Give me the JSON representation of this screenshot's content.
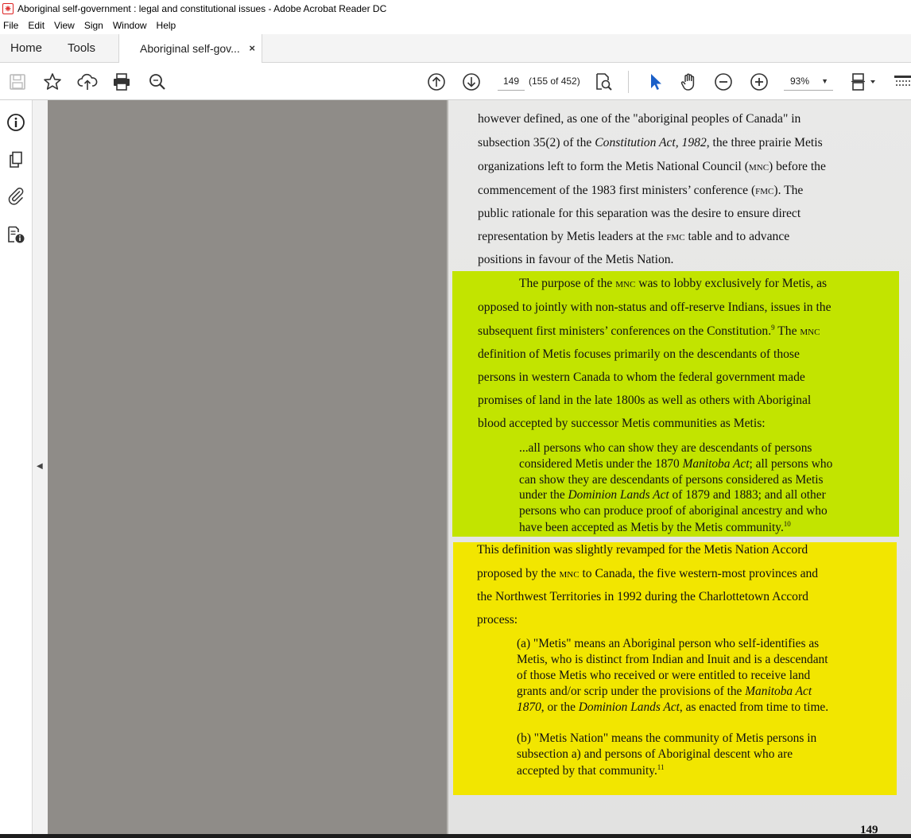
{
  "window": {
    "title": "Aboriginal self-government : legal and constitutional issues - Adobe Acrobat Reader DC"
  },
  "menu": [
    "File",
    "Edit",
    "View",
    "Sign",
    "Window",
    "Help"
  ],
  "tabs": {
    "home": "Home",
    "tools": "Tools",
    "document": "Aboriginal self-gov...",
    "close": "×"
  },
  "toolbar": {
    "page_number": "149",
    "page_count": "(155 of 452)",
    "zoom": "93%",
    "icons": [
      "save-icon",
      "bookmark-star-icon",
      "upload-icon",
      "print-icon",
      "search-zoom-icon",
      "page-up-icon",
      "page-down-icon",
      "find-page-icon",
      "select-cursor-icon",
      "hand-icon",
      "zoom-out-icon",
      "zoom-in-icon",
      "page-layout-icon",
      "more-tools-icon"
    ]
  },
  "left_rail": [
    "info-icon",
    "pages-icon",
    "attachment-icon",
    "document-properties-icon"
  ],
  "document": {
    "para1": [
      "however defined, as one of the \"aboriginal peoples of Canada\" in",
      "subsection 35(2) of the ",
      "organizations left to form the Metis National Council (",
      "commencement of the 1983 first ministers’ conference (",
      "public rationale for this separation was the desire to ensure direct",
      "representation by Metis leaders at the ",
      "positions in favour of the Metis Nation."
    ],
    "constitution_act": "Constitution Act, 1982",
    "line2_end": ", the three prairie Metis",
    "mnc": "mnc",
    "fmc": "fmc",
    "line3_end": ") before the",
    "line4_end": "). The",
    "line6_end": " table and to advance",
    "para2": [
      "The purpose of the ",
      " was to lobby exclusively for Metis, as",
      "opposed to jointly with non-status and off-reserve Indians, issues in the",
      "subsequent first ministers’ conferences on the Constitution.",
      "9",
      " The ",
      "definition of Metis focuses primarily on the descendants of those",
      "persons in western Canada to whom the federal government made",
      "promises of land in the late 1800s as well as others with Aboriginal",
      "blood accepted by successor Metis communities as Metis:"
    ],
    "quote1": [
      "...all persons who can show they are descendants of persons",
      "considered Metis under the 1870 ",
      "Manitoba Act",
      "; all persons who",
      "can show they are descendants of persons considered as Metis",
      "under the ",
      "Dominion Lands Act",
      " of 1879 and 1883; and all other",
      "persons who can produce proof of aboriginal ancestry and who",
      "have been accepted as Metis by the Metis community.",
      "10"
    ],
    "para3": [
      "This definition was slightly revamped for the Metis Nation Accord",
      "proposed by the ",
      " to Canada, the five western-most provinces and",
      "the Northwest Territories in 1992 during the Charlottetown Accord",
      "process:"
    ],
    "quote2": [
      "(a) \"Metis\" means an Aboriginal person who self-identifies as",
      "Metis, who is distinct from Indian and Inuit and is a descendant",
      "of those Metis who received or were entitled to receive land",
      "grants and/or scrip under the provisions of the ",
      "Manitoba Act",
      "1870",
      ", or the ",
      "Dominion Lands Act",
      ", as enacted from time to time."
    ],
    "quote3": [
      "(b) \"Metis Nation\" means the community of Metis persons in",
      "subsection a) and persons of Aboriginal descent who are",
      "accepted by that community.",
      "11"
    ],
    "page_number": "149"
  },
  "colors": {
    "highlight_green": "#c2e400",
    "highlight_yellow": "#f2e600",
    "select_tool": "#1a5fc8"
  }
}
